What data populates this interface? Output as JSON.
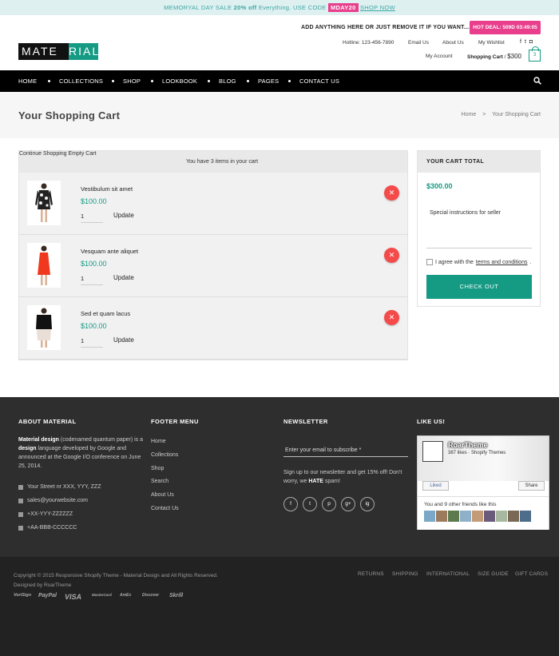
{
  "promo": {
    "prefix": "MEMORYAL DAY SALE",
    "pct": "20% off",
    "mid": "Everything. USE CODE",
    "code": "MDAY20",
    "shop": "SHOP NOW"
  },
  "header": {
    "logo_a": "MATE",
    "logo_b": "RIAL",
    "note": "ADD ANYTHING HERE OR JUST REMOVE IT IF YOU WANT...",
    "hot_deal": "HOT DEAL: 509D 03:49:05",
    "hotline": "Hotline: 123-456-7890",
    "email_us": "Email Us",
    "about_us": "About Us",
    "wishlist": "My Wishlist",
    "my_account": "My Account",
    "cart_label": "Shopping Cart",
    "cart_amount": "$300",
    "cart_count": "3"
  },
  "nav": [
    "HOME",
    "COLLECTIONS",
    "SHOP",
    "LOOKBOOK",
    "BLOG",
    "PAGES",
    "CONTACT US"
  ],
  "title_bar": {
    "title": "Your Shopping Cart",
    "crumb_home": "Home",
    "crumb_sep": ">",
    "crumb_current": "Your Shopping Cart"
  },
  "cart": {
    "continue": "Continue Shopping",
    "summary": "You have 3 items in your cart",
    "empty": "Empty Cart",
    "update_label": "Update",
    "items": [
      {
        "name": "Vestibulum sit amet",
        "price": "$100.00",
        "qty": "1"
      },
      {
        "name": "Vesquam ante aliquet",
        "price": "$100.00",
        "qty": "1"
      },
      {
        "name": "Sed et quam lacus",
        "price": "$100.00",
        "qty": "1"
      }
    ]
  },
  "total": {
    "heading": "YOUR CART TOTAL",
    "amount": "$300.00",
    "instructions": "Special instructions for seller",
    "agree_pre": "I agree with the",
    "agree_link": "terms and conditions",
    "agree_post": ".",
    "checkout": "CHECK OUT"
  },
  "footer": {
    "about_title": "ABOUT MATERIAL",
    "about_b1": "Material design",
    "about_t1": " (codenamed quantum paper) is a ",
    "about_b2": "design",
    "about_t2": " language developed by Google and announced at the Google I/O conference on June 25, 2014.",
    "address": "Your Street nr XXX, YYY, ZZZ",
    "email": "sales@yourwebsite.com",
    "phone1": "+XX-YYY-ZZZZZZ",
    "phone2": "+AA-BBB-CCCCCC",
    "menu_title": "FOOTER MENU",
    "menu": [
      "Home",
      "Collections",
      "Shop",
      "Search",
      "About Us",
      "Contact Us"
    ],
    "news_title": "NEWSLETTER",
    "news_placeholder": "Enter your email to subscribe *",
    "news_text": "Sign up to our newsletter and get 15% off! Don't worry, we ",
    "news_hate": "HATE",
    "news_end": " spam!",
    "social": [
      "f",
      "t",
      "p",
      "g+",
      "ig"
    ],
    "like_title": "LIKE US!",
    "fb_name": "RoarTheme",
    "fb_likes": "387 likes",
    "fb_sub": "Shopify Themes",
    "fb_liked": "Liked",
    "fb_share": "Share",
    "fb_friends": "You and 9 other friends like this"
  },
  "bottom": {
    "copy1": "Copyright © 2015 Responsive Shopify Theme - Material Design and All Rights Reserved.",
    "copy2": "Designed by RoarTheme",
    "links": [
      "RETURNS",
      "SHIPPING",
      "INTERNATIONAL",
      "SIZE GUIDE",
      "GIFT CARDS"
    ],
    "payments": [
      "VeriSign",
      "PayPal",
      "VISA",
      "MasterCard",
      "AmEx",
      "Discover",
      "Skrill"
    ]
  },
  "colors": {
    "accent": "#159a84",
    "pink": "#e83e8c",
    "remove": "#f44a4a"
  }
}
